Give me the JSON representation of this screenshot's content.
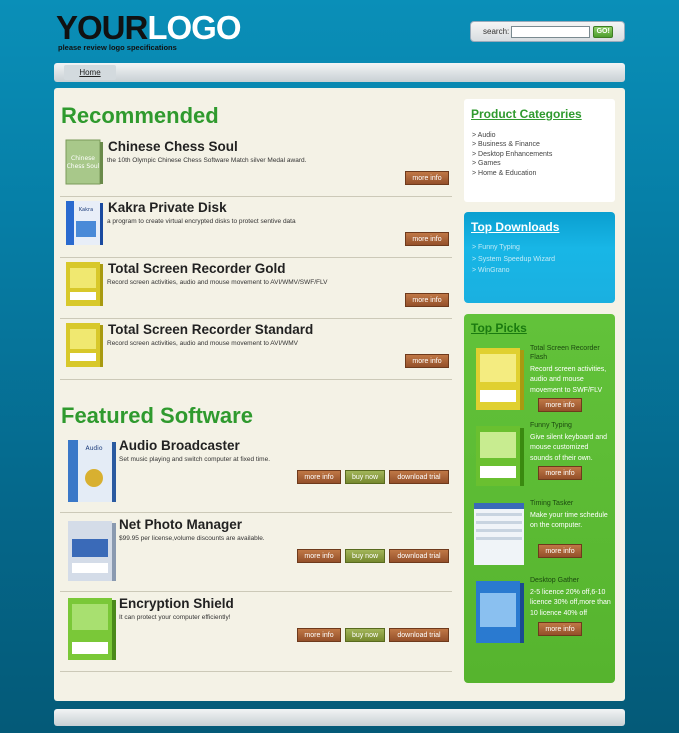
{
  "header": {
    "logo_your": "YOUR",
    "logo_logo": "LOGO",
    "logo_tagline": "please review logo specifications",
    "search_label": "search:",
    "search_value": "",
    "search_button": "GO!"
  },
  "nav": {
    "home": "Home"
  },
  "recommended": {
    "title": "Recommended",
    "items": [
      {
        "title": "Chinese Chess Soul",
        "desc": "the 10th Olympic Chinese Chess Software Match silver Medal award.",
        "button": "more info"
      },
      {
        "title": "Kakra Private Disk",
        "desc": "a program to create virtual encrypted disks to protect sentive data",
        "button": "more info"
      },
      {
        "title": "Total Screen Recorder Gold",
        "desc": "Record screen activities, audio and mouse movement to AVI/WMV/SWF/FLV",
        "button": "more info"
      },
      {
        "title": "Total Screen Recorder Standard",
        "desc": "Record screen activities, audio and mouse movement to AVI/WMV",
        "button": "more info"
      }
    ]
  },
  "featured": {
    "title": "Featured Software",
    "items": [
      {
        "title": "Audio Broadcaster",
        "desc": "Set music playing and switch computer at fixed time.",
        "more": "more info",
        "buy": "buy now",
        "trial": "download trial"
      },
      {
        "title": "Net Photo Manager",
        "desc": "$99.95 per license,volume discounts are available.",
        "more": "more info",
        "buy": "buy now",
        "trial": "download trial"
      },
      {
        "title": "Encryption Shield",
        "desc": "It can protect your computer efficiently!",
        "more": "more info",
        "buy": "buy now",
        "trial": "download trial"
      }
    ]
  },
  "sidebar": {
    "categories": {
      "title": "Product Categories",
      "items": [
        "> Audio",
        "> Business & Finance",
        "> Desktop Enhancements",
        "> Games",
        "> Home & Education"
      ]
    },
    "downloads": {
      "title": "Top Downloads",
      "items": [
        "> Funny Typing",
        "> System Speedup Wizard",
        "> WinGrano"
      ]
    },
    "picks": {
      "title": "Top Picks",
      "items": [
        {
          "title": "Total Screen Recorder",
          "title2": "Flash",
          "desc": "Record screen activities, audio and mouse movement to SWF/FLV",
          "button": "more info"
        },
        {
          "title": "Funny Typing",
          "title2": "",
          "desc": "Give silent keyboard and mouse customized sounds of their own.",
          "button": "more info"
        },
        {
          "title": "Timing Tasker",
          "title2": "",
          "desc": "Make your time schedule on the computer.",
          "button": "more info"
        },
        {
          "title": "Desktop Gather",
          "title2": "",
          "desc": "2-5 licence 20% off,6-10 licence 30% off,more than 10 licence 40% off",
          "button": "more info"
        }
      ]
    }
  },
  "colors": {
    "accent_green": "#2f9a2e",
    "button_brown": "#a8623a",
    "button_green": "#8a9e44",
    "sidebar_blue": "#18b6e6",
    "sidebar_green": "#5cbb34"
  }
}
